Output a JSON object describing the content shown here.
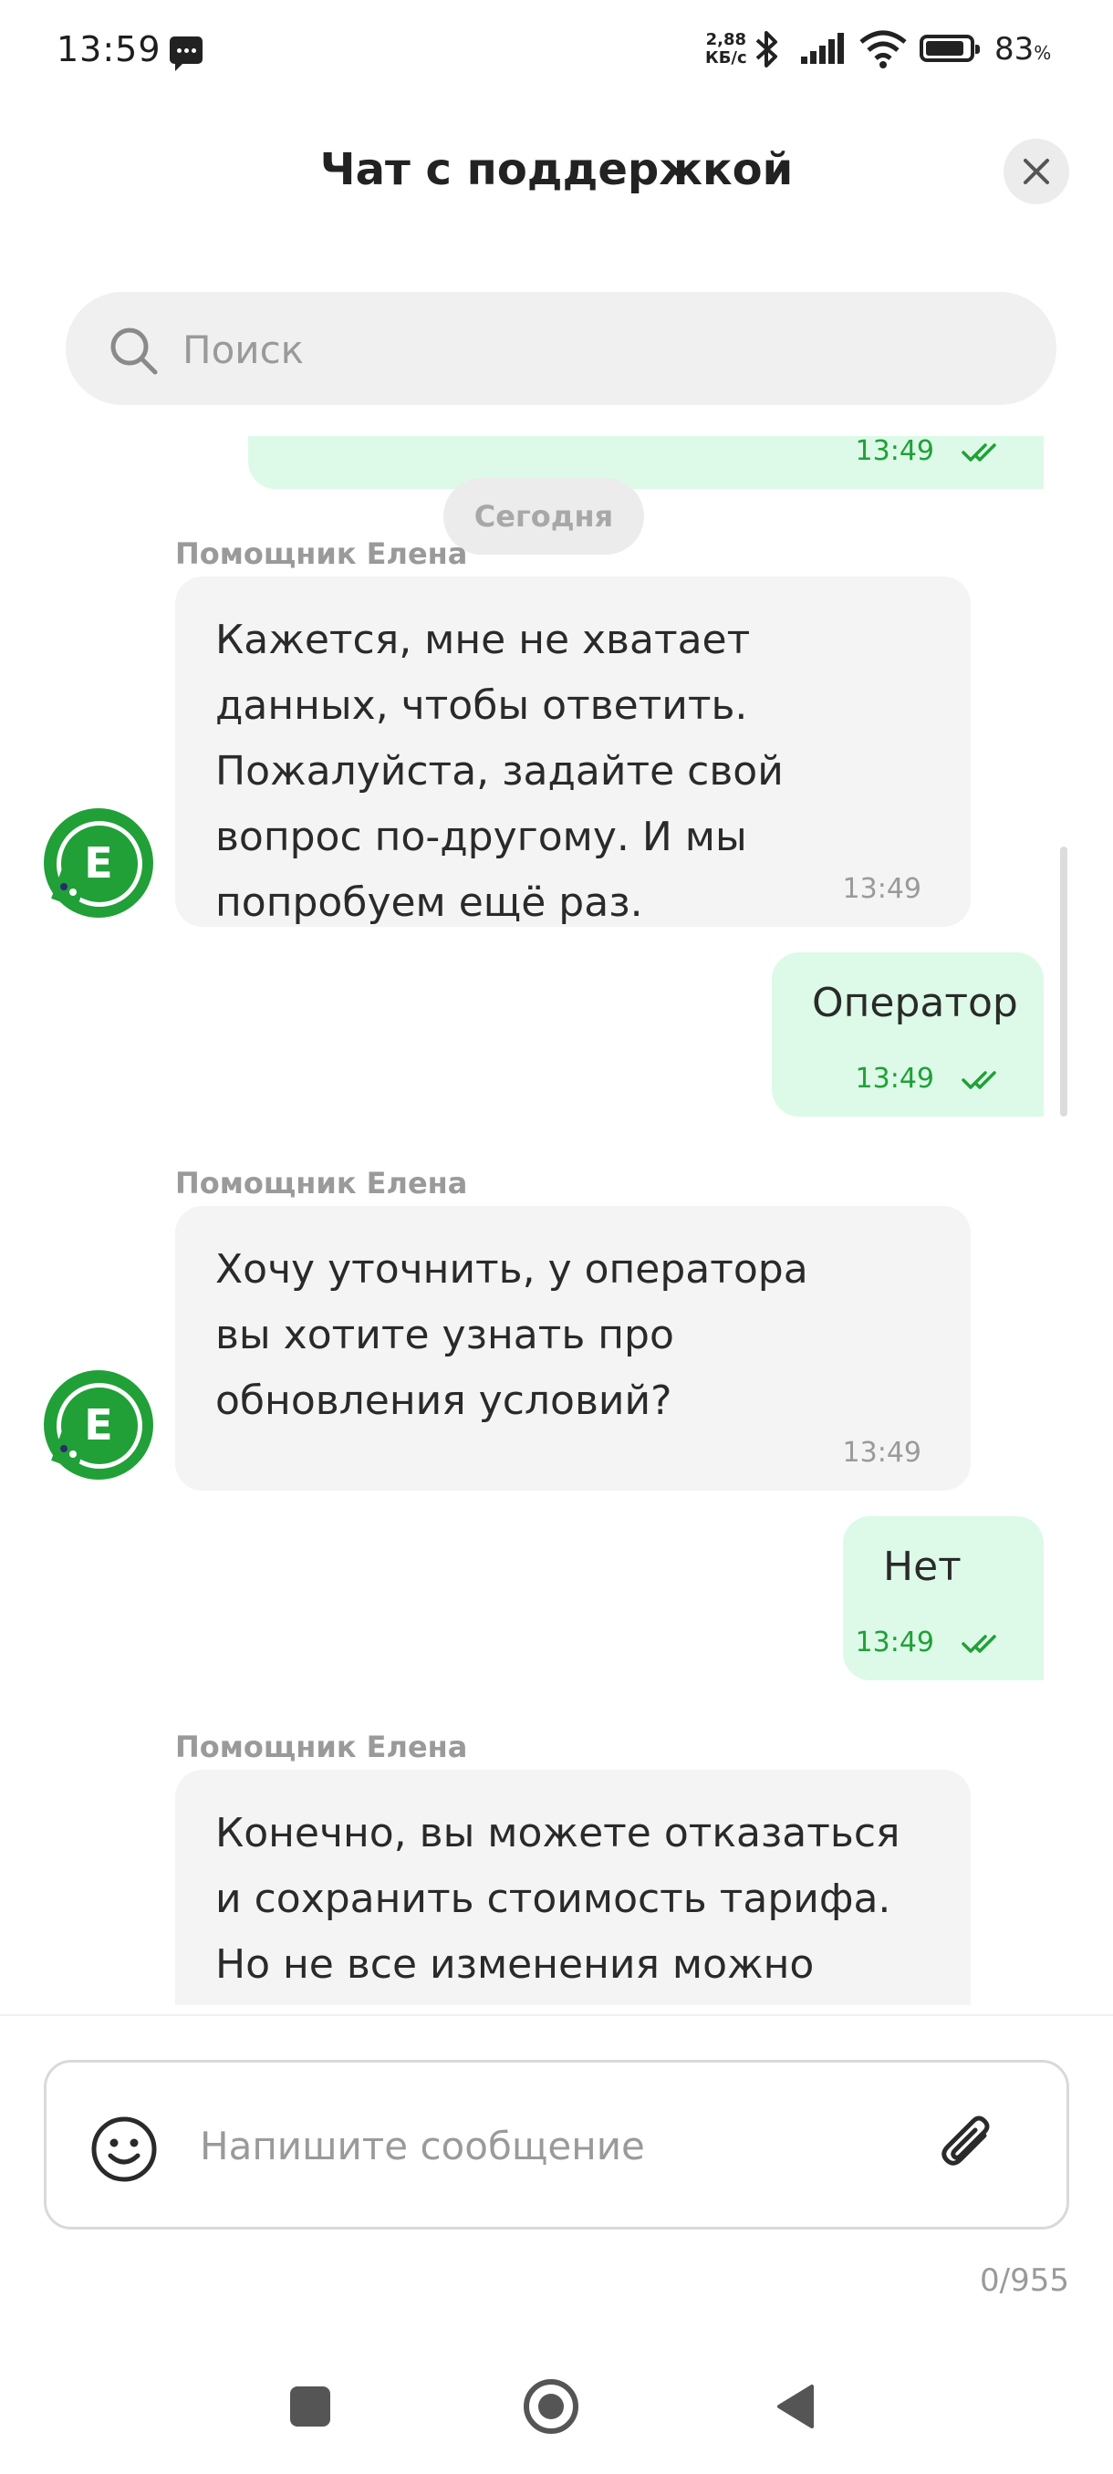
{
  "status_bar": {
    "time": "13:59",
    "speed_value": "2,88",
    "speed_unit": "КБ/с",
    "battery": "83",
    "battery_unit": "%"
  },
  "header": {
    "title": "Чат с поддержкой",
    "close_icon": "close-icon"
  },
  "search": {
    "placeholder": "Поиск",
    "value": ""
  },
  "chat": {
    "partial_top_time": "13:49",
    "date_separator": "Сегодня",
    "messages": [
      {
        "from": "bot",
        "sender": "Помощник Елена",
        "text": "Кажется, мне не хватает данных, чтобы ответить. Пожалуйста, задайте свой вопрос по-другому. И мы попробуем ещё раз.",
        "time": "13:49"
      },
      {
        "from": "user",
        "text": "Оператор",
        "time": "13:49"
      },
      {
        "from": "bot",
        "sender": "Помощник Елена",
        "text": "Хочу уточнить, у оператора вы хотите узнать про обновления условий?",
        "time": "13:49"
      },
      {
        "from": "user",
        "text": "Нет",
        "time": "13:49"
      },
      {
        "from": "bot",
        "sender": "Помощник Елена",
        "text": "Конечно, вы можете отказаться и сохранить стоимость тарифа. Но не все изменения можно",
        "time": ""
      }
    ],
    "avatar_letter": "E"
  },
  "composer": {
    "placeholder": "Напишите сообщение",
    "value": "",
    "counter": "0/955"
  },
  "colors": {
    "brand_green": "#21a038",
    "outgoing_bubble": "#dcfae7",
    "incoming_bubble": "#f4f4f4"
  }
}
